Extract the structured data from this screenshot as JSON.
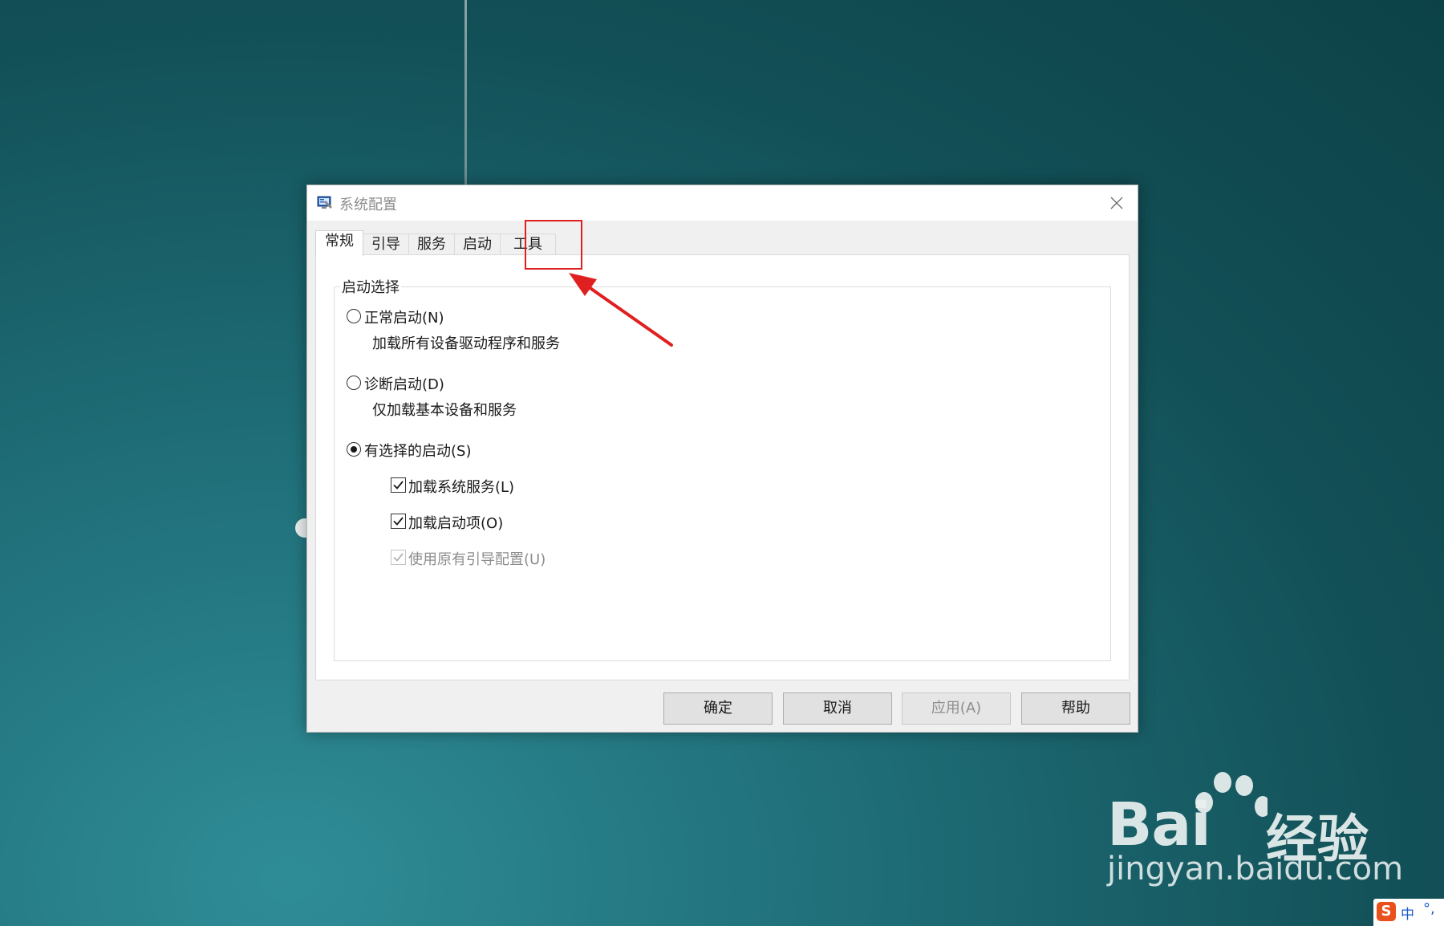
{
  "window": {
    "title": "系统配置",
    "close_icon": "close-icon"
  },
  "tabs": [
    {
      "label": "常规",
      "active": true
    },
    {
      "label": "引导",
      "active": false
    },
    {
      "label": "服务",
      "active": false
    },
    {
      "label": "启动",
      "active": false
    },
    {
      "label": "工具",
      "active": false
    }
  ],
  "startup": {
    "group_title": "启动选择",
    "normal": {
      "label": "正常启动(N)",
      "desc": "加载所有设备驱动程序和服务",
      "checked": false
    },
    "diagnostic": {
      "label": "诊断启动(D)",
      "desc": "仅加载基本设备和服务",
      "checked": false
    },
    "selective": {
      "label": "有选择的启动(S)",
      "checked": true
    },
    "load_services": {
      "label": "加载系统服务(L)",
      "checked": true
    },
    "load_startup": {
      "label": "加载启动项(O)",
      "checked": true
    },
    "use_original_boot": {
      "label": "使用原有引导配置(U)",
      "checked": true,
      "disabled": true
    }
  },
  "buttons": {
    "ok": "确定",
    "cancel": "取消",
    "apply": "应用(A)",
    "help": "帮助"
  },
  "watermark": {
    "brand": "Bai",
    "brand_cn": "经验",
    "url": "jingyan.baidu.com"
  },
  "ime": {
    "logo": "S",
    "lang": "中",
    "dots": "°,"
  },
  "colors": {
    "annotation": "#e02020"
  }
}
